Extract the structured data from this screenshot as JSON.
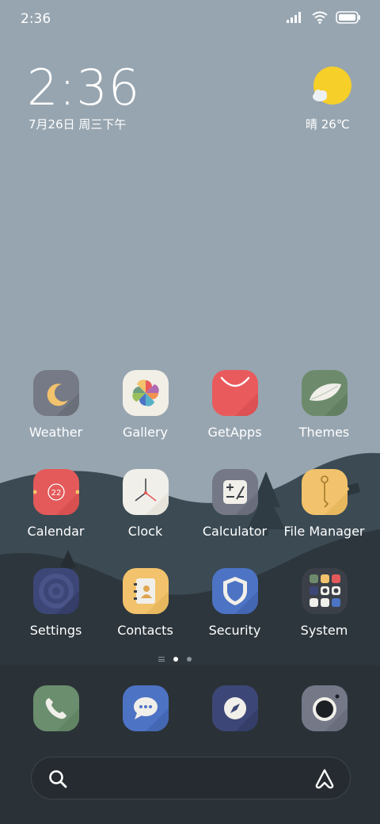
{
  "status_bar": {
    "time": "2:36"
  },
  "widget": {
    "time": "2:36",
    "date": "7月26日 周三下午",
    "weather": "晴 26℃"
  },
  "apps": [
    {
      "label": "Weather"
    },
    {
      "label": "Gallery"
    },
    {
      "label": "GetApps"
    },
    {
      "label": "Themes"
    },
    {
      "label": "Calendar",
      "badge": "22"
    },
    {
      "label": "Clock"
    },
    {
      "label": "Calculator"
    },
    {
      "label": "File Manager"
    },
    {
      "label": "Settings"
    },
    {
      "label": "Contacts"
    },
    {
      "label": "Security"
    },
    {
      "label": "System"
    }
  ],
  "dock": [
    "phone-icon",
    "messages-icon",
    "browser-icon",
    "camera-icon"
  ],
  "colors": {
    "sky": "#97a5b0",
    "hill_far": "#3b4a53",
    "hill_near": "#2a3237",
    "weather": "#767a86",
    "gallery": "#f2efe6",
    "getapps": "#e95a5d",
    "themes": "#6d8b6c",
    "calendar": "#e45a5a",
    "clock": "#f1efe9",
    "calculator": "#757887",
    "file_manager": "#f2c36c",
    "settings": "#3d4777",
    "contacts": "#f2c36c",
    "security": "#4d73c4",
    "system": "#3b4048",
    "phone": "#6a8e6e",
    "messages": "#4d73c4",
    "browser": "#3d4777",
    "camera": "#757887"
  }
}
